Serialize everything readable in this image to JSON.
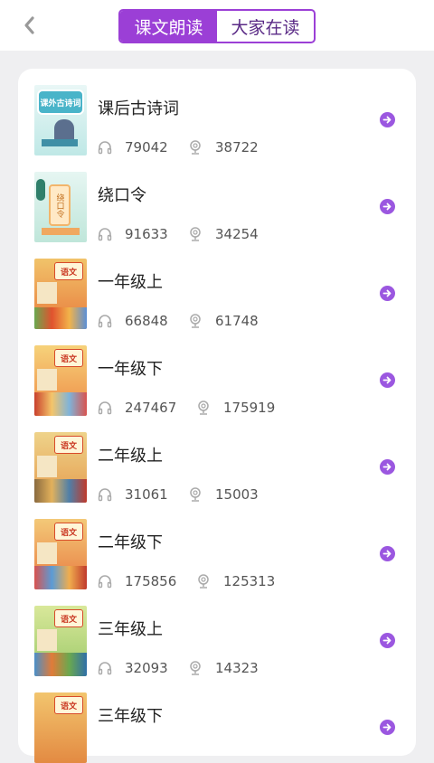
{
  "header": {
    "tabs": [
      {
        "label": "课文朗读",
        "active": true
      },
      {
        "label": "大家在读",
        "active": false
      }
    ]
  },
  "colors": {
    "accent": "#9b3fd6",
    "arrow": "#9b57e0",
    "background": "#efeff1"
  },
  "items": [
    {
      "title": "课后古诗词",
      "listens": "79042",
      "recordings": "38722",
      "cover_text": "课外古诗词"
    },
    {
      "title": "绕口令",
      "listens": "91633",
      "recordings": "34254",
      "cover_text": "绕口令"
    },
    {
      "title": "一年级上",
      "listens": "66848",
      "recordings": "61748",
      "cover_text": "语文"
    },
    {
      "title": "一年级下",
      "listens": "247467",
      "recordings": "175919",
      "cover_text": "语文"
    },
    {
      "title": "二年级上",
      "listens": "31061",
      "recordings": "15003",
      "cover_text": "语文"
    },
    {
      "title": "二年级下",
      "listens": "175856",
      "recordings": "125313",
      "cover_text": "语文"
    },
    {
      "title": "三年级上",
      "listens": "32093",
      "recordings": "14323",
      "cover_text": "语文"
    },
    {
      "title": "三年级下",
      "cover_text": "语文"
    }
  ]
}
